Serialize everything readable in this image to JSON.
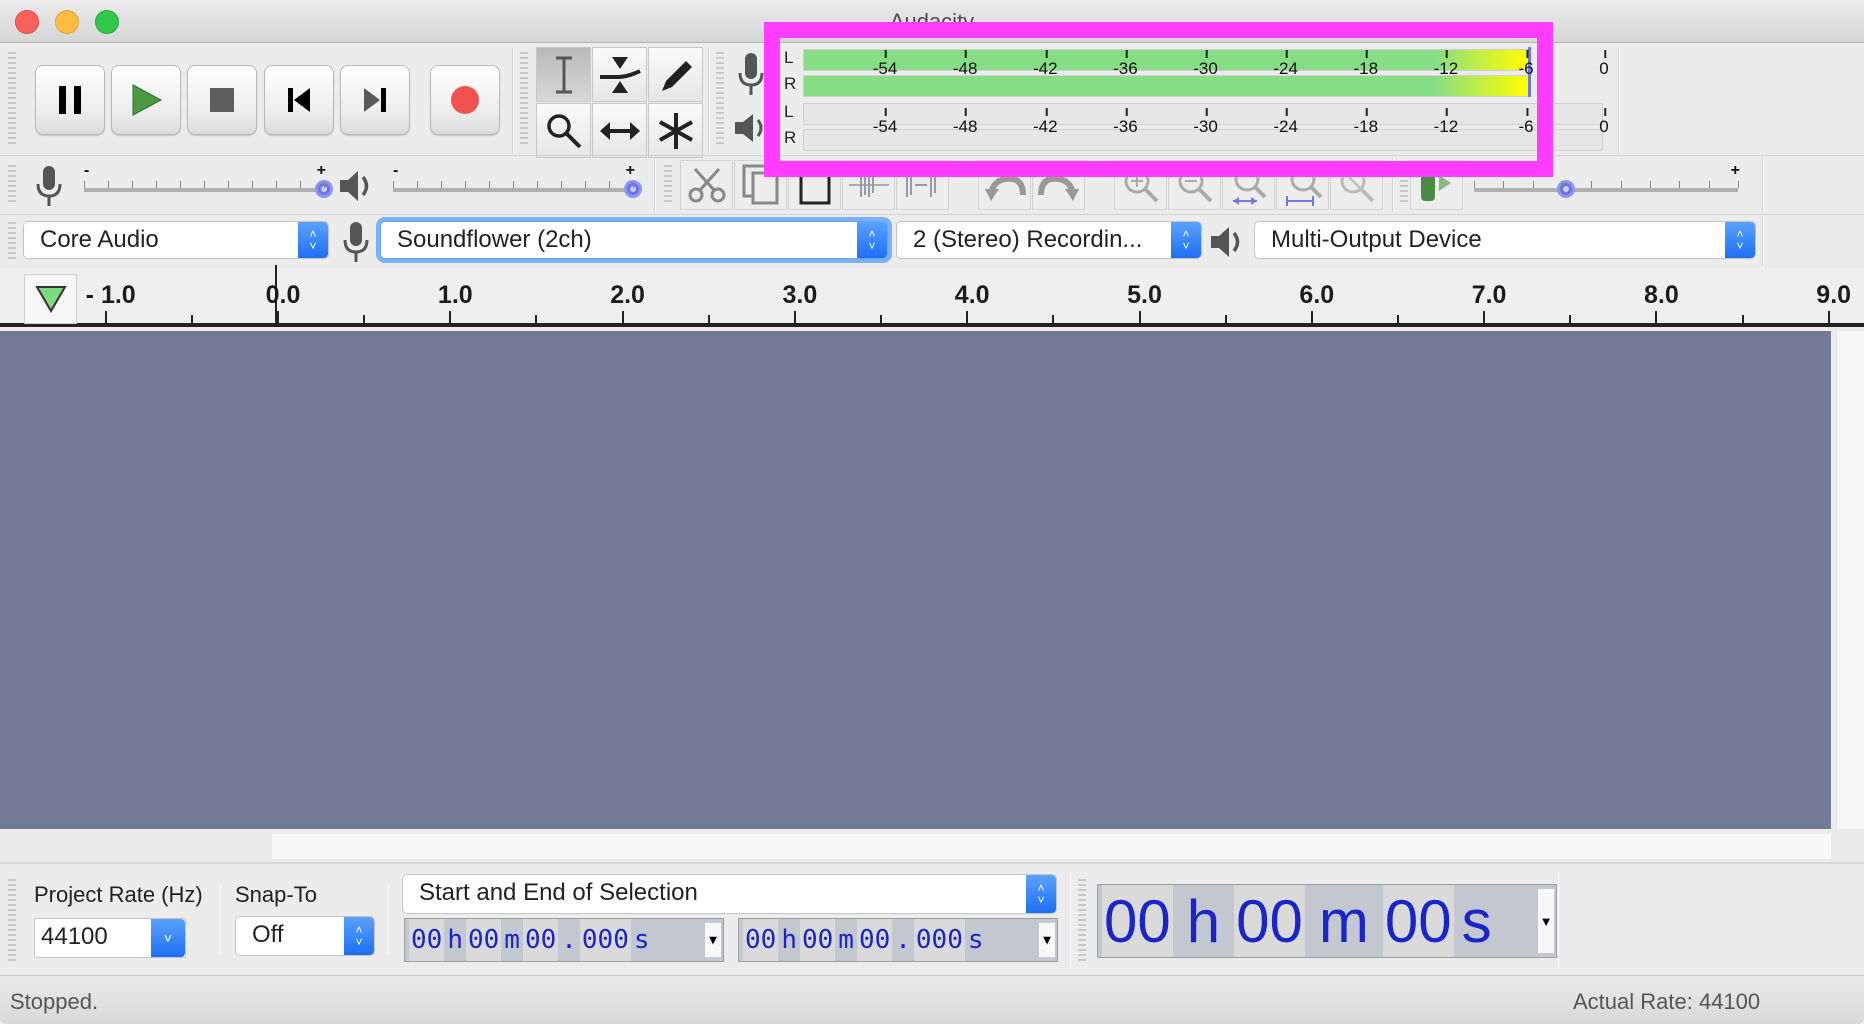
{
  "window": {
    "title": "Audacity"
  },
  "transport": {
    "buttons": [
      {
        "name": "pause",
        "icon": "pause-icon"
      },
      {
        "name": "play",
        "icon": "play-icon"
      },
      {
        "name": "stop",
        "icon": "stop-icon"
      },
      {
        "name": "skip-to-start",
        "icon": "skip-start-icon"
      },
      {
        "name": "skip-to-end",
        "icon": "skip-end-icon"
      },
      {
        "name": "record",
        "icon": "record-icon"
      }
    ]
  },
  "tools": {
    "items": [
      "selection-tool",
      "envelope-tool",
      "draw-tool",
      "zoom-tool",
      "time-shift-tool",
      "multi-tool"
    ],
    "active": "selection-tool"
  },
  "meters": {
    "recording": {
      "channels": [
        "L",
        "R"
      ],
      "level_db": -6,
      "peak_db": -6
    },
    "playback": {
      "channels": [
        "L",
        "R"
      ],
      "level_db": null
    },
    "scale": [
      "-54",
      "-48",
      "-42",
      "-36",
      "-30",
      "-24",
      "-18",
      "-12",
      "-6",
      "0"
    ],
    "colors": {
      "green": "#86dd86",
      "yellow": "#ffff00",
      "peak": "#7178e2",
      "highlight": "#ff3cff"
    }
  },
  "mixer": {
    "recording_volume": {
      "min_label": "-",
      "max_label": "+",
      "value": 1.0
    },
    "playback_volume": {
      "min_label": "-",
      "max_label": "+",
      "value": 1.0
    }
  },
  "edit_toolbar": {
    "buttons": [
      "cut",
      "copy",
      "paste",
      "trim",
      "silence",
      "undo",
      "redo",
      "zoom-in",
      "zoom-out",
      "fit-selection",
      "fit-project",
      "zoom-toggle"
    ]
  },
  "play_at_speed": {
    "value": 0.35,
    "max_label": "+"
  },
  "devices": {
    "host": "Core Audio",
    "recording_device": "Soundflower (2ch)",
    "recording_channels": "2 (Stereo) Recordin...",
    "playback_device": "Multi-Output Device"
  },
  "ruler": {
    "labels": [
      "- 1.0",
      "0.0",
      "1.0",
      "2.0",
      "3.0",
      "4.0",
      "5.0",
      "6.0",
      "7.0",
      "8.0",
      "9.0"
    ]
  },
  "selection_toolbar": {
    "project_rate_label": "Project Rate (Hz)",
    "project_rate": "44100",
    "snap_to_label": "Snap-To",
    "snap_to": "Off",
    "selection_mode": "Start and End of Selection",
    "start_time": {
      "hh": "00",
      "mm": "00",
      "ss": "00",
      "ms": "000"
    },
    "end_time": {
      "hh": "00",
      "mm": "00",
      "ss": "00",
      "ms": "000"
    },
    "audio_position": {
      "hh": "00",
      "mm": "00",
      "ss": "00"
    },
    "units": {
      "h": "h",
      "m": "m",
      "s": "s",
      "dot": "."
    }
  },
  "status": {
    "left": "Stopped.",
    "right": "Actual Rate: 44100"
  }
}
